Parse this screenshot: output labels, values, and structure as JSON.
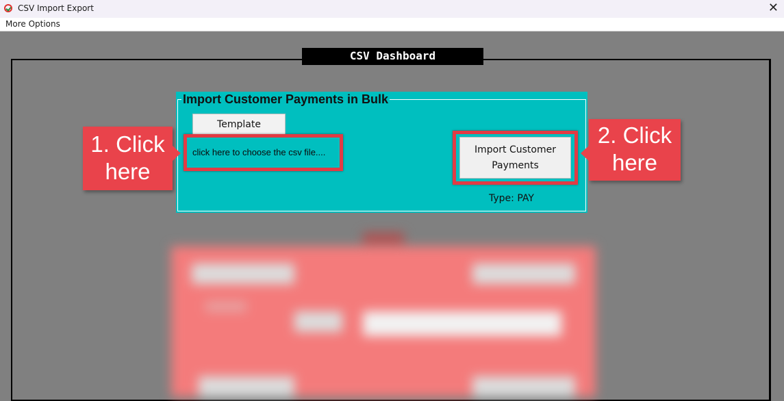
{
  "window": {
    "title": "CSV Import Export",
    "close_glyph": "✕"
  },
  "menu": {
    "more_options": "More Options"
  },
  "dashboard": {
    "title": "CSV Dashboard"
  },
  "panel": {
    "title": "Import Customer Payments in Bulk",
    "template_label": "Template",
    "file_placeholder": "click here to choose the csv file....",
    "import_label": "Import Customer Payments",
    "type_label": "Type: PAY"
  },
  "callouts": {
    "step1_line1": "1. Click",
    "step1_line2": "here",
    "step2_line1": "2. Click",
    "step2_line2": "here"
  },
  "colors": {
    "panel_bg": "#00bfbf",
    "highlight": "#e23b44",
    "callout_bg": "#e9434b",
    "dashboard_bg": "#808080"
  },
  "icons": {
    "app": "app-logo-icon",
    "close": "close-icon"
  }
}
